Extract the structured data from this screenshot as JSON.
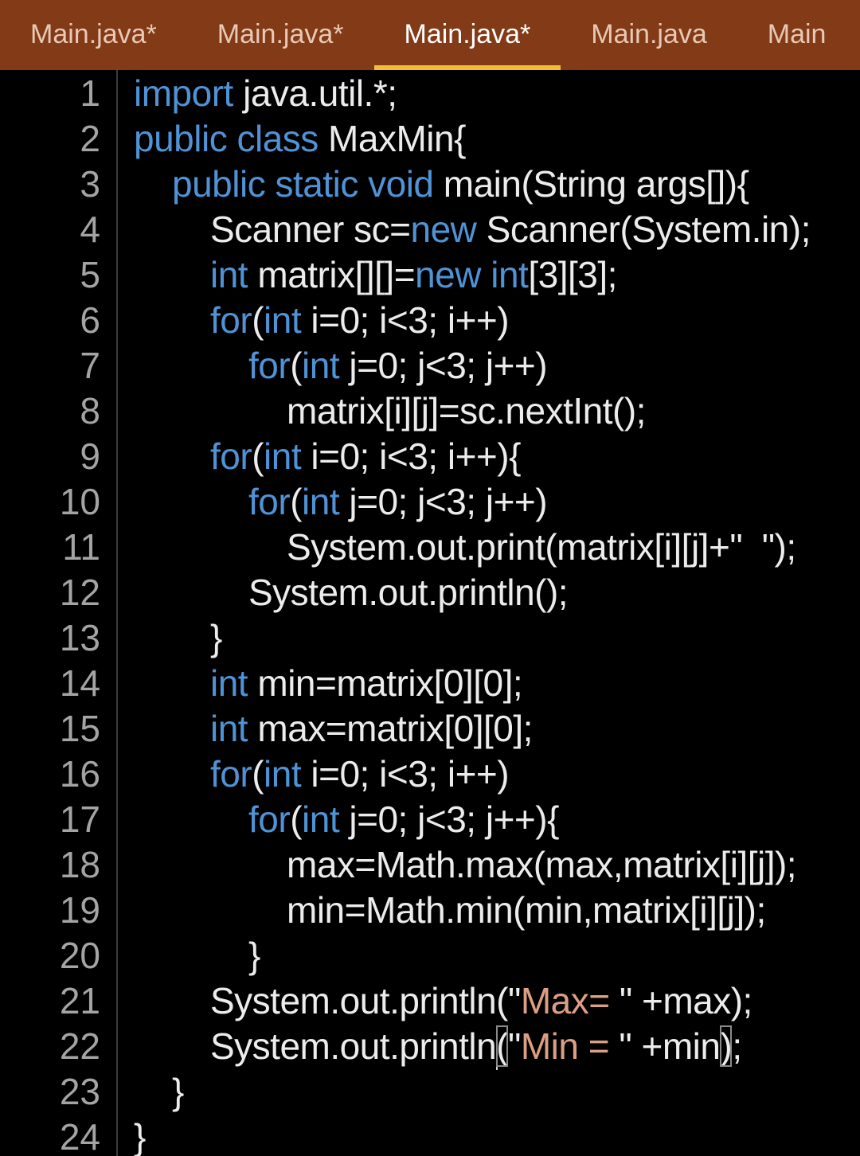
{
  "tabs": [
    {
      "label": "Main.java*",
      "active": false
    },
    {
      "label": "Main.java*",
      "active": false
    },
    {
      "label": "Main.java*",
      "active": true
    },
    {
      "label": "Main.java",
      "active": false
    },
    {
      "label": "Main",
      "active": false
    }
  ],
  "colors": {
    "tab_bar": "#833a16",
    "active_tab_indicator": "#f2be32",
    "keyword": "#4f93d6",
    "string": "#dd9e84",
    "text": "#ececec",
    "line_number": "#a4a4a4",
    "background": "#000000"
  },
  "code_lines": [
    {
      "n": "1",
      "indent": 0,
      "tokens": [
        {
          "t": "import",
          "k": "kw"
        },
        {
          "t": " java.util.*;"
        }
      ]
    },
    {
      "n": "2",
      "indent": 0,
      "tokens": [
        {
          "t": "public class",
          "k": "kw"
        },
        {
          "t": " MaxMin{"
        }
      ]
    },
    {
      "n": "3",
      "indent": 1,
      "tokens": [
        {
          "t": "public static void",
          "k": "kw"
        },
        {
          "t": " main(String args[]){"
        }
      ]
    },
    {
      "n": "4",
      "indent": 2,
      "tokens": [
        {
          "t": "Scanner sc="
        },
        {
          "t": "new",
          "k": "kw"
        },
        {
          "t": " Scanner(System.in);"
        }
      ]
    },
    {
      "n": "5",
      "indent": 2,
      "tokens": [
        {
          "t": "int",
          "k": "kw"
        },
        {
          "t": " matrix[][]="
        },
        {
          "t": "new int",
          "k": "kw"
        },
        {
          "t": "[3][3];"
        }
      ]
    },
    {
      "n": "6",
      "indent": 2,
      "tokens": [
        {
          "t": "for",
          "k": "kw"
        },
        {
          "t": "("
        },
        {
          "t": "int",
          "k": "kw"
        },
        {
          "t": " i=0; i<3; i++)"
        }
      ]
    },
    {
      "n": "7",
      "indent": 3,
      "tokens": [
        {
          "t": "for",
          "k": "kw"
        },
        {
          "t": "("
        },
        {
          "t": "int",
          "k": "kw"
        },
        {
          "t": " j=0; j<3; j++)"
        }
      ]
    },
    {
      "n": "8",
      "indent": 4,
      "tokens": [
        {
          "t": "matrix[i][j]=sc.nextInt();"
        }
      ]
    },
    {
      "n": "9",
      "indent": 2,
      "tokens": [
        {
          "t": "for",
          "k": "kw"
        },
        {
          "t": "("
        },
        {
          "t": "int",
          "k": "kw"
        },
        {
          "t": " i=0; i<3; i++){"
        }
      ]
    },
    {
      "n": "10",
      "indent": 3,
      "tokens": [
        {
          "t": "for",
          "k": "kw"
        },
        {
          "t": "("
        },
        {
          "t": "int",
          "k": "kw"
        },
        {
          "t": " j=0; j<3; j++)"
        }
      ]
    },
    {
      "n": "11",
      "indent": 4,
      "tokens": [
        {
          "t": "System.out.print(matrix[i][j]+\"  \");"
        }
      ]
    },
    {
      "n": "12",
      "indent": 3,
      "tokens": [
        {
          "t": "System.out.println();"
        }
      ]
    },
    {
      "n": "13",
      "indent": 2,
      "tokens": [
        {
          "t": "}"
        }
      ]
    },
    {
      "n": "14",
      "indent": 2,
      "tokens": [
        {
          "t": "int",
          "k": "kw"
        },
        {
          "t": " min=matrix[0][0];"
        }
      ]
    },
    {
      "n": "15",
      "indent": 2,
      "tokens": [
        {
          "t": "int",
          "k": "kw"
        },
        {
          "t": " max=matrix[0][0];"
        }
      ]
    },
    {
      "n": "16",
      "indent": 2,
      "tokens": [
        {
          "t": "for",
          "k": "kw"
        },
        {
          "t": "("
        },
        {
          "t": "int",
          "k": "kw"
        },
        {
          "t": " i=0; i<3; i++)"
        }
      ]
    },
    {
      "n": "17",
      "indent": 3,
      "tokens": [
        {
          "t": "for",
          "k": "kw"
        },
        {
          "t": "("
        },
        {
          "t": "int",
          "k": "kw"
        },
        {
          "t": " j=0; j<3; j++){"
        }
      ]
    },
    {
      "n": "18",
      "indent": 4,
      "tokens": [
        {
          "t": "max=Math.max(max,matrix[i][j]);"
        }
      ]
    },
    {
      "n": "19",
      "indent": 4,
      "tokens": [
        {
          "t": "min=Math.min(min,matrix[i][j]);"
        }
      ]
    },
    {
      "n": "20",
      "indent": 3,
      "tokens": [
        {
          "t": "}"
        }
      ]
    },
    {
      "n": "21",
      "indent": 2,
      "tokens": [
        {
          "t": "System.out.println(\""
        },
        {
          "t": "Max= ",
          "k": "str"
        },
        {
          "t": "\" +max);"
        }
      ]
    },
    {
      "n": "22",
      "indent": 2,
      "tokens": [
        {
          "t": "System.out.println",
          "cursor_after": true
        },
        {
          "t": "(",
          "k": "boxed"
        },
        {
          "t": "\""
        },
        {
          "t": "Min = ",
          "k": "str"
        },
        {
          "t": "\" +min"
        },
        {
          "t": ")",
          "k": "boxed"
        },
        {
          "t": ";"
        }
      ]
    },
    {
      "n": "23",
      "indent": 1,
      "tokens": [
        {
          "t": "}"
        }
      ]
    },
    {
      "n": "24",
      "indent": 0,
      "tokens": [
        {
          "t": "}"
        }
      ]
    }
  ]
}
